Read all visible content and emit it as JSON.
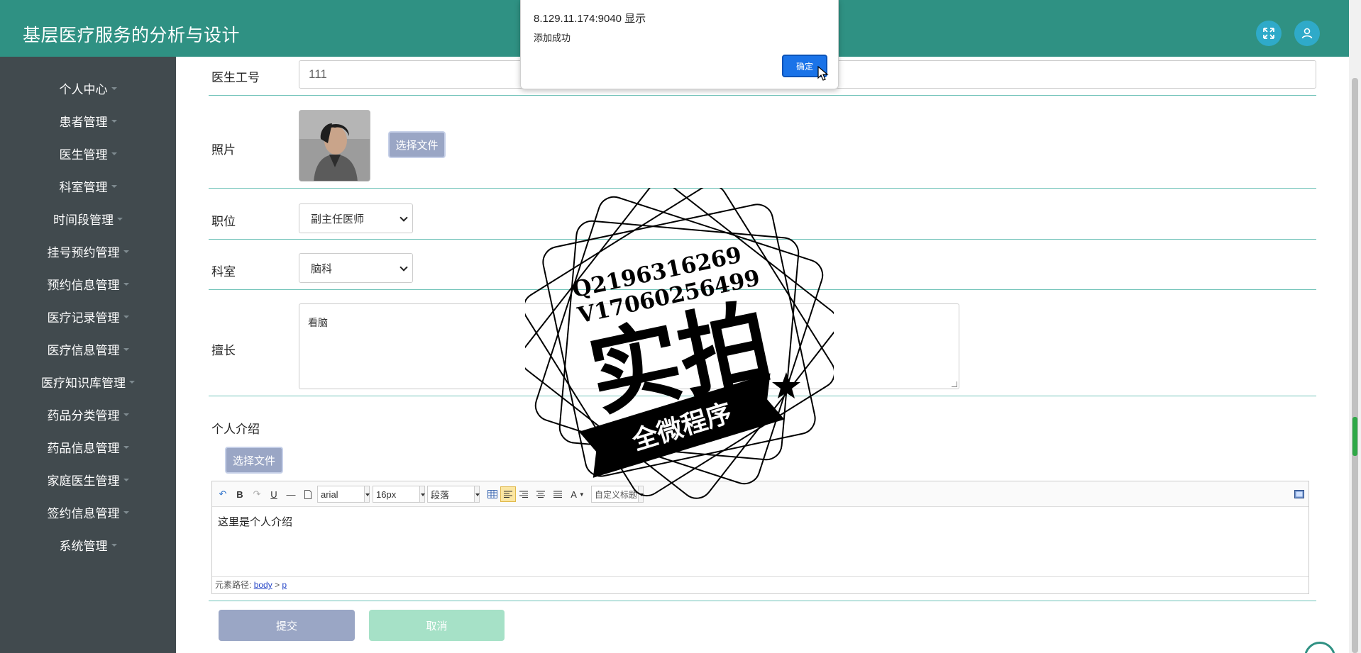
{
  "header": {
    "title": "基层医疗服务的分析与设计",
    "icons": [
      "fullscreen-icon",
      "user-icon"
    ]
  },
  "sidebar": {
    "items": [
      {
        "label": "个人中心"
      },
      {
        "label": "患者管理"
      },
      {
        "label": "医生管理"
      },
      {
        "label": "科室管理"
      },
      {
        "label": "时间段管理"
      },
      {
        "label": "挂号预约管理"
      },
      {
        "label": "预约信息管理"
      },
      {
        "label": "医疗记录管理"
      },
      {
        "label": "医疗信息管理"
      },
      {
        "label": "医疗知识库管理"
      },
      {
        "label": "药品分类管理"
      },
      {
        "label": "药品信息管理"
      },
      {
        "label": "家庭医生管理"
      },
      {
        "label": "签约信息管理"
      },
      {
        "label": "系统管理"
      }
    ]
  },
  "form": {
    "doctor_id": {
      "label": "医生工号",
      "value": "111"
    },
    "photo": {
      "label": "照片",
      "button": "选择文件"
    },
    "position": {
      "label": "职位",
      "value": "副主任医师"
    },
    "department": {
      "label": "科室",
      "value": "脑科"
    },
    "specialty": {
      "label": "擅长",
      "value": "看脑"
    },
    "intro": {
      "label": "个人介绍",
      "button": "选择文件",
      "font": "arial",
      "size": "16px",
      "paragraph": "段落",
      "custom_title": "自定义标题",
      "content": "这里是个人介绍",
      "path_label": "元素路径:",
      "path_body": "body",
      "path_sep": ">",
      "path_p": "p"
    },
    "submit": "提交",
    "cancel": "取消"
  },
  "alert": {
    "origin": "8.129.11.174:9040 显示",
    "message": "添加成功",
    "ok": "确定"
  },
  "watermark": {
    "line1": "Q2196316269",
    "line2": "V17060256499",
    "main": "实拍",
    "banner": "全微程序"
  },
  "colors": {
    "header": "#2f9183",
    "sidebar": "#414a4e",
    "divider": "#6fc2b8",
    "file_button": "#9aa6c5",
    "submit": "#9aa6c5",
    "cancel": "#a6e1c7",
    "alert_ok": "#1a73e8"
  }
}
